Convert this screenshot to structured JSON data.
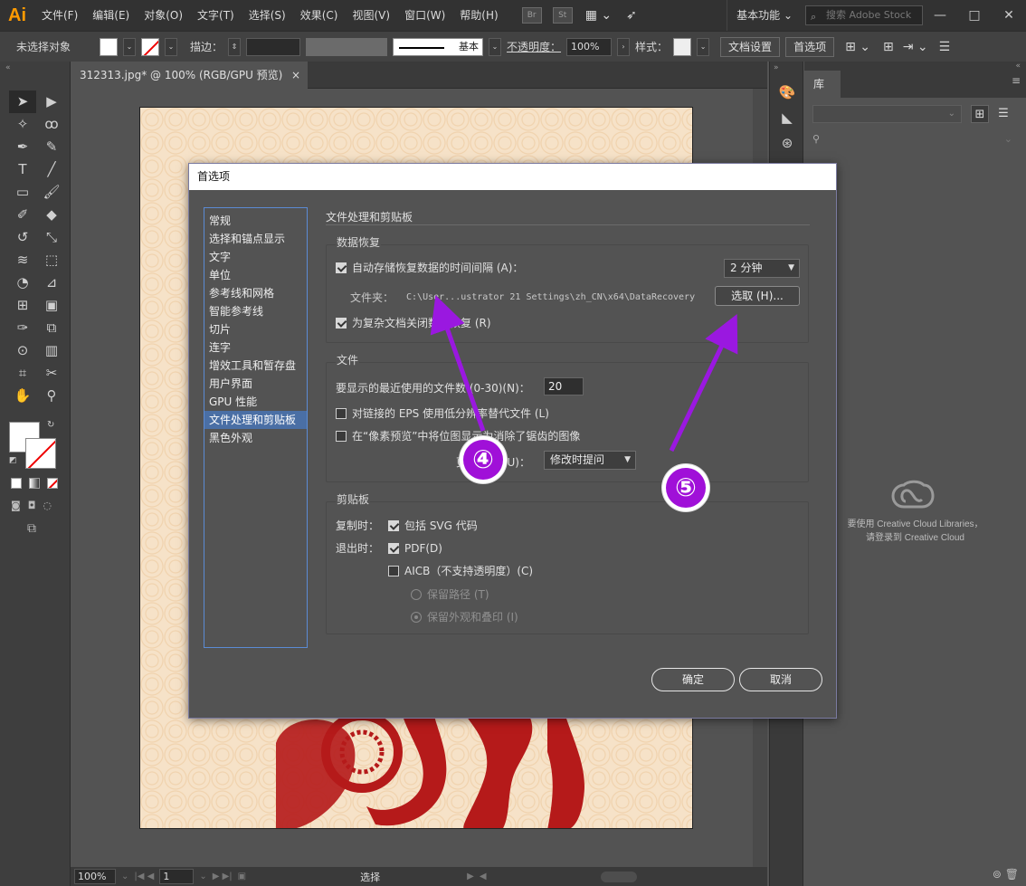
{
  "app": {
    "logo": "Ai",
    "menus": [
      "文件(F)",
      "编辑(E)",
      "对象(O)",
      "文字(T)",
      "选择(S)",
      "效果(C)",
      "视图(V)",
      "窗口(W)",
      "帮助(H)"
    ],
    "bridge_icon": "Br",
    "stock_icon": "St",
    "workspace": "基本功能",
    "search_placeholder": "搜索 Adobe Stock"
  },
  "control_bar": {
    "selection": "未选择对象",
    "stroke_label": "描边：",
    "stroke_style": "基本",
    "opacity_label": "不透明度：",
    "opacity_value": "100%",
    "style_label": "样式：",
    "doc_setup": "文档设置",
    "preferences": "首选项"
  },
  "document": {
    "tab_title": "312313.jpg* @ 100% (RGB/GPU 预览)",
    "tab_close": "×"
  },
  "statusbar": {
    "zoom": "100%",
    "page": "1",
    "tool": "选择"
  },
  "library": {
    "tab": "库",
    "message_line1": "要使用 Creative Cloud Libraries，",
    "message_line2": "请登录到 Creative Cloud"
  },
  "dialog": {
    "title": "首选项",
    "categories": [
      "常规",
      "选择和锚点显示",
      "文字",
      "单位",
      "参考线和网格",
      "智能参考线",
      "切片",
      "连字",
      "增效工具和暂存盘",
      "用户界面",
      "GPU 性能",
      "文件处理和剪贴板",
      "黑色外观"
    ],
    "selected_index": 11,
    "section_title": "文件处理和剪贴板",
    "recovery": {
      "title": "数据恢复",
      "autosave_label": "自动存储恢复数据的时间间隔 (A)：",
      "interval": "2 分钟",
      "folder_label": "文件夹：",
      "folder_path": "C:\\User...ustrator 21 Settings\\zh_CN\\x64\\DataRecovery",
      "choose_button": "选取 (H)...",
      "complex_label": "为复杂文档关闭数据恢复 (R)"
    },
    "files": {
      "title": "文件",
      "recent_label": "要显示的最近使用的文件数 (0-30)(N)：",
      "recent_value": "20",
      "eps_label": "对链接的 EPS 使用低分辨率替代文件 (L)",
      "pixel_label": "在“像素预览”中将位图显示为消除了锯齿的图像",
      "update_label": "更新链接 (U)：",
      "update_value": "修改时提问"
    },
    "clipboard": {
      "title": "剪贴板",
      "copy_label": "复制时：",
      "svg_label": "包括 SVG 代码",
      "exit_label": "退出时：",
      "pdf_label": "PDF(D)",
      "aicb_label": "AICB（不支持透明度）(C)",
      "paths_label": "保留路径 (T)",
      "appearance_label": "保留外观和叠印 (I)"
    },
    "ok": "确定",
    "cancel": "取消"
  },
  "annotations": {
    "badge4": "④",
    "badge5": "⑤",
    "color": "#9a18e0"
  }
}
